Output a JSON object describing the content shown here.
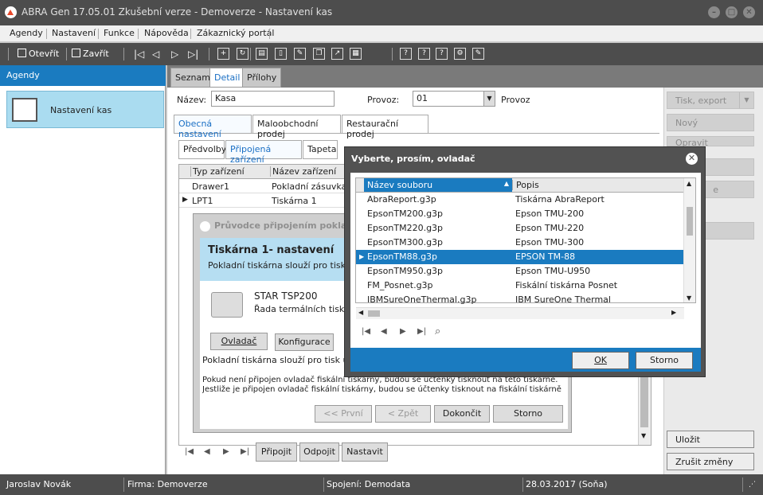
{
  "window": {
    "title": "ABRA Gen 17.05.01 Zkušební verze - Demoverze - Nastavení kas"
  },
  "menu": [
    "Agendy",
    "Nastavení",
    "Funkce",
    "Nápověda",
    "Zákaznický portál"
  ],
  "toolbar": {
    "open_label": "Otevřít",
    "close_label": "Zavřít"
  },
  "left": {
    "header": "Agendy",
    "item_label": "Nastavení kas"
  },
  "main_tabs": [
    "Seznam",
    "Detail",
    "Přílohy"
  ],
  "form": {
    "name_label": "Název:",
    "name_value": "Kasa",
    "provoz_label": "Provoz:",
    "provoz_value": "01",
    "provoz_text": "Provoz"
  },
  "sub_tabs": [
    "Obecná nastavení",
    "Maloobchodní prodej",
    "Restaurační prodej"
  ],
  "inner_tabs": [
    "Předvolby",
    "Připojená zařízení",
    "Tapeta"
  ],
  "devices": {
    "columns": [
      "Typ zařízení",
      "Název zařízení"
    ],
    "rows": [
      [
        "Drawer1",
        "Pokladní zásuvka"
      ],
      [
        "LPT1",
        "Tiskárna 1"
      ]
    ]
  },
  "wizard": {
    "title": "Průvodce připojením pokladn",
    "heading": "Tiskárna 1- nastavení",
    "subheading": "Pokladní tiskárna slouží pro tisk účte",
    "printer_name": "STAR TSP200",
    "printer_desc": "Řada termálních tiskáre",
    "btn_driver": "Ovladač",
    "btn_config": "Konfigurace",
    "text1": "Pokladní tiskárna slouží pro tisk účten",
    "text2": "Pokud není připojen ovladač fiskální tiskárny, budou se účtenky tisknout na této tiskárně.",
    "text3": "Jestliže je připojen ovladač fiskální tiskárny, budou se účtenky tisknout na fiskální tiskárně",
    "btn_first": "<< První",
    "btn_prev": "< Zpět",
    "btn_finish": "Dokončit",
    "btn_cancel": "Storno"
  },
  "bottom_buttons": [
    "Připojit",
    "Odpojit",
    "Nastavit"
  ],
  "right_buttons": {
    "print_export": "Tisk, export",
    "new": "Nový",
    "fix": "Opravit",
    "copy_partial": "rat",
    "del_partial": "e",
    "nav_partial": "vit",
    "save": "Uložit",
    "cancel_changes": "Zrušit změny"
  },
  "dialog": {
    "title": "Vyberte, prosím, ovladač",
    "columns": [
      "Název souboru",
      "Popis"
    ],
    "rows": [
      [
        "AbraReport.g3p",
        "Tiskárna AbraReport"
      ],
      [
        "EpsonTM200.g3p",
        "Epson TMU-200"
      ],
      [
        "EpsonTM220.g3p",
        "Epson TMU-220"
      ],
      [
        "EpsonTM300.g3p",
        "Epson TMU-300"
      ],
      [
        "EpsonTM88.g3p",
        "EPSON TM-88"
      ],
      [
        "EpsonTM950.g3p",
        "Epson TMU-U950"
      ],
      [
        "FM_Posnet.g3p",
        "Fiskální tiskárna Posnet"
      ],
      [
        "IBMSureOneThermal.g3p",
        "IBM SureOne Thermal"
      ]
    ],
    "selected_index": 4,
    "ok": "OK",
    "cancel": "Storno"
  },
  "status": {
    "user": "Jaroslav Novák",
    "firm": "Firma: Demoverze",
    "connection": "Spojení: Demodata",
    "date": "28.03.2017 (Soňa)"
  },
  "colors": {
    "accent": "#1a7bc0",
    "dark": "#4d4d4d",
    "selection": "#aadcf0"
  }
}
